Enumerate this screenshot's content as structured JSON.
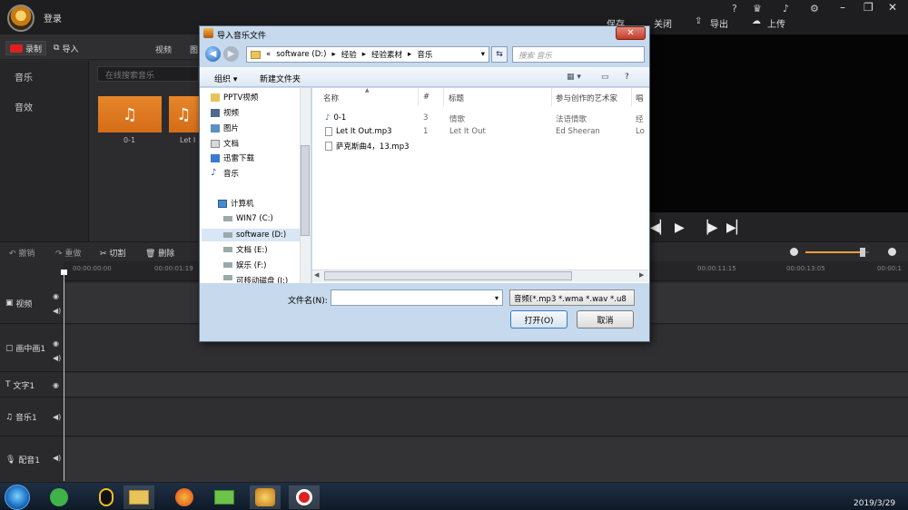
{
  "app": {
    "login_label": "登录",
    "header_actions": {
      "save": "保存",
      "close": "关闭",
      "export": "导出",
      "upload": "上传"
    },
    "top_icons": [
      "help-icon",
      "crown-icon",
      "bell-icon",
      "gear-icon",
      "minimize-icon",
      "restore-icon",
      "close-icon"
    ],
    "help_glyph": "?",
    "left_toolbar": {
      "record": "录制",
      "import": "导入",
      "tab_video": "视频",
      "tab_image": "图"
    },
    "categories": [
      "音乐",
      "音效"
    ],
    "search_placeholder": "在线搜索音乐",
    "thumbs": [
      {
        "label": "0-1"
      },
      {
        "label": "Let I"
      }
    ],
    "timeline_tools": [
      "撤销",
      "重做",
      "切割",
      "删除"
    ],
    "ruler": [
      "00:00:00:00",
      "00:00:01:19",
      "00:00:11:15",
      "00:00:13:05",
      "00:00:1"
    ],
    "tracks": [
      {
        "label": "视频"
      },
      {
        "label": "画中画1"
      },
      {
        "label": "文字1"
      },
      {
        "label": "音乐1"
      },
      {
        "label": "配音1"
      }
    ],
    "clock": "2019/3/29"
  },
  "dialog": {
    "title": "导入音乐文件",
    "breadcrumb": [
      "«",
      "software (D:)",
      "经验",
      "经验素材",
      "音乐"
    ],
    "search_placeholder": "搜索 音乐",
    "organize": "组织 ▾",
    "new_folder": "新建文件夹",
    "nav_items": [
      {
        "label": "PPTV视频",
        "icon": "folder-icon"
      },
      {
        "label": "视频",
        "icon": "video-icon"
      },
      {
        "label": "图片",
        "icon": "picture-icon"
      },
      {
        "label": "文档",
        "icon": "document-icon"
      },
      {
        "label": "迅雷下载",
        "icon": "download-icon"
      },
      {
        "label": "音乐",
        "icon": "music-icon"
      },
      {
        "label": "计算机",
        "icon": "computer-icon"
      },
      {
        "label": "WIN7 (C:)",
        "icon": "drive-icon"
      },
      {
        "label": "software (D:)",
        "icon": "drive-icon"
      },
      {
        "label": "文档 (E:)",
        "icon": "drive-icon"
      },
      {
        "label": "娱乐 (F:)",
        "icon": "drive-icon"
      },
      {
        "label": "可移动磁盘 (I:)",
        "icon": "drive-icon"
      }
    ],
    "columns": [
      "名称",
      "#",
      "标题",
      "参与创作的艺术家",
      "唱"
    ],
    "files": [
      {
        "name": "0-1",
        "num": "3",
        "title": "情歌",
        "artist": "法语情歌",
        "extra": "经"
      },
      {
        "name": "Let It Out.mp3",
        "num": "1",
        "title": "Let It Out",
        "artist": "Ed Sheeran",
        "extra": "Lo"
      },
      {
        "name": "萨克斯曲4，13.mp3",
        "num": "",
        "title": "",
        "artist": "",
        "extra": ""
      }
    ],
    "filename_label": "文件名(N):",
    "filename_value": "",
    "filetype": "音频(*.mp3 *.wma *.wav *.u8",
    "open": "打开(O)",
    "cancel": "取消"
  },
  "colors": {
    "accent": "#e9a03a",
    "record": "#e02020",
    "dialog": "#c7d9ec"
  }
}
